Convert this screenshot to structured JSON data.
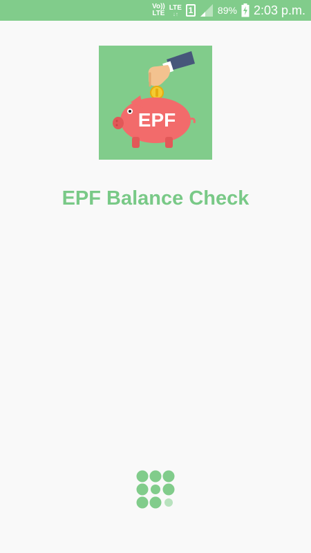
{
  "status_bar": {
    "volte_line1": "Vo))",
    "volte_line2": "LTE",
    "network_type": "LTE",
    "network_arrows": "↓↑",
    "sim_slot": "1",
    "battery_percent": "89%",
    "time": "2:03 p.m.",
    "bar_color": "#81cc8b"
  },
  "splash": {
    "logo_text": "EPF",
    "app_title": "EPF Balance Check",
    "accent_color": "#79c987"
  },
  "icons": {
    "signal": "signal-icon",
    "battery": "battery-charging-icon",
    "loader": "loading-dots-icon"
  }
}
